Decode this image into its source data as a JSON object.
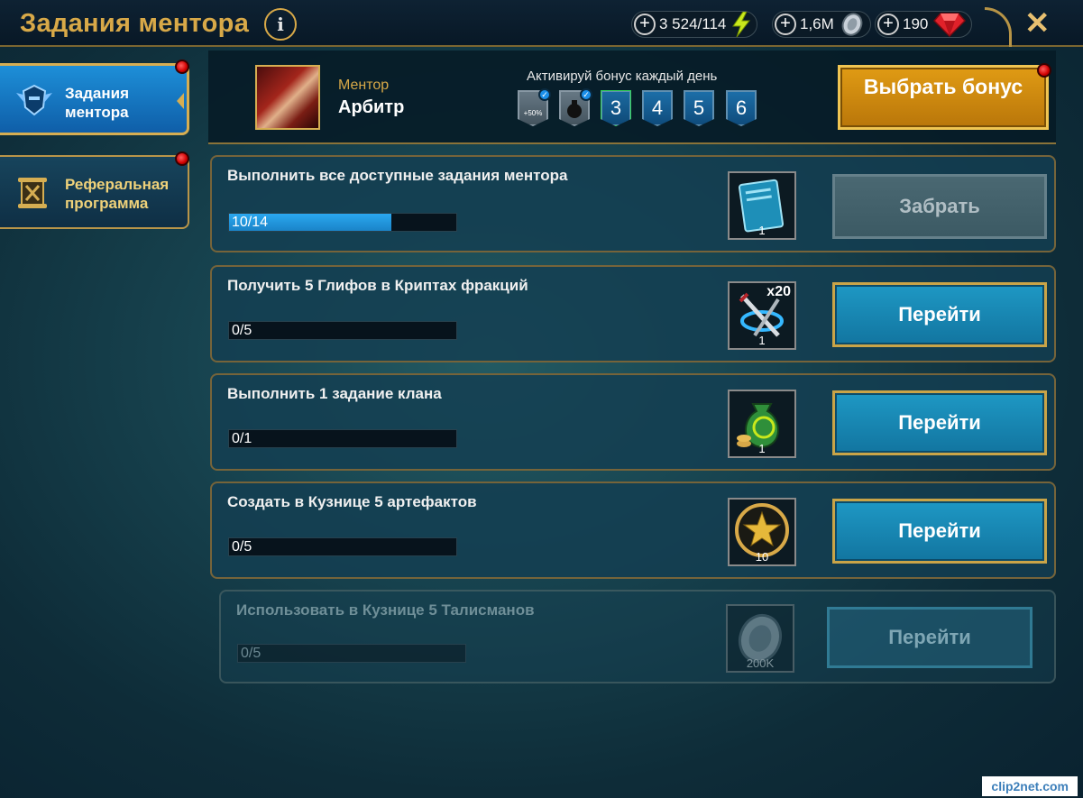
{
  "header": {
    "title": "Задания ментора",
    "info_icon": "i",
    "resources": [
      {
        "name": "energy",
        "value": "3 524/114",
        "icon": "lightning-icon"
      },
      {
        "name": "silver",
        "value": "1,6M",
        "icon": "coin-icon"
      },
      {
        "name": "gems",
        "value": "190",
        "icon": "ruby-icon"
      }
    ],
    "plus_symbol": "+",
    "close_symbol": "✕"
  },
  "sidebar": {
    "items": [
      {
        "label": "Задания ментора",
        "icon": "mentor-helmet-icon",
        "active": true
      },
      {
        "label": "Реферальная программа",
        "icon": "scroll-icon",
        "active": false
      }
    ]
  },
  "mentor": {
    "label": "Ментор",
    "name": "Арбитр",
    "bonus_title": "Активируй бонус каждый день",
    "bonus_days": [
      {
        "label": "+50%",
        "state": "claimed"
      },
      {
        "label": "",
        "state": "claimed"
      },
      {
        "label": "3",
        "state": "current"
      },
      {
        "label": "4",
        "state": "locked"
      },
      {
        "label": "5",
        "state": "locked"
      },
      {
        "label": "6",
        "state": "locked"
      }
    ],
    "check_symbol": "✓",
    "choose_button": "Выбрать бонус"
  },
  "quests": [
    {
      "title": "Выполнить все доступные задания ментора",
      "progress": "10/14",
      "fraction": 0.714,
      "reward_icon": "blue-book-icon",
      "reward_count": "1",
      "reward_mult": "",
      "button": "Забрать",
      "button_state": "disabled"
    },
    {
      "title": "Получить 5 Глифов в Криптах фракций",
      "progress": "0/5",
      "fraction": 0,
      "reward_icon": "crossed-swords-icon",
      "reward_count": "1",
      "reward_mult": "x20",
      "button": "Перейти",
      "button_state": "active"
    },
    {
      "title": "Выполнить 1 задание клана",
      "progress": "0/1",
      "fraction": 0,
      "reward_icon": "money-bag-icon",
      "reward_count": "1",
      "reward_mult": "",
      "button": "Перейти",
      "button_state": "active"
    },
    {
      "title": "Создать в Кузнице 5 артефактов",
      "progress": "0/5",
      "fraction": 0,
      "reward_icon": "star-medal-icon",
      "reward_count": "10",
      "reward_mult": "",
      "button": "Перейти",
      "button_state": "active"
    },
    {
      "title": "Использовать в Кузнице 5 Талисманов",
      "progress": "0/5",
      "fraction": 0,
      "reward_icon": "silver-coin-icon",
      "reward_count": "200K",
      "reward_mult": "",
      "button": "Перейти",
      "button_state": "faded"
    }
  ],
  "watermark": "clip2net.com",
  "colors": {
    "gold": "#d8a948",
    "accent_blue": "#1e98c4",
    "progress_fill": "#2aa8f0",
    "notify_red": "#d00000"
  }
}
